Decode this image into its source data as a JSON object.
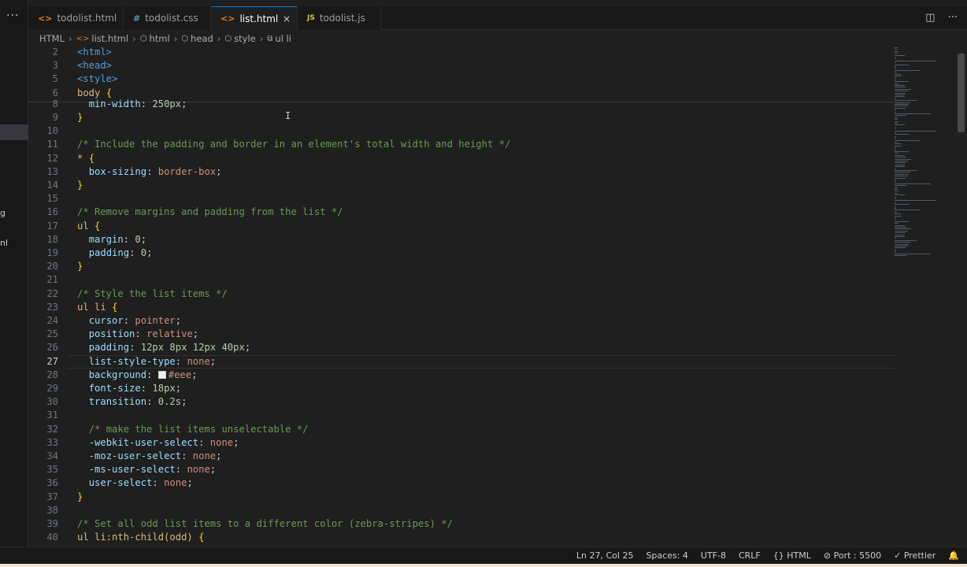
{
  "sidebar": {
    "menu_icon": "ellipsis-icon",
    "fragments": [
      "g",
      "nl"
    ]
  },
  "tabs": [
    {
      "label": "todolist.html",
      "icon": "html-file-icon",
      "icon_glyph": "<>",
      "active": false
    },
    {
      "label": "todolist.css",
      "icon": "css-file-icon",
      "icon_glyph": "#",
      "active": false
    },
    {
      "label": "list.html",
      "icon": "html-file-icon",
      "icon_glyph": "<>",
      "active": true
    },
    {
      "label": "todolist.js",
      "icon": "js-file-icon",
      "icon_glyph": "JS",
      "active": false
    }
  ],
  "tab_close": "×",
  "breadcrumb": [
    {
      "label": "HTML",
      "icon": ""
    },
    {
      "label": "list.html",
      "icon": "html-file-icon"
    },
    {
      "label": "html",
      "icon": "symbol-element-icon"
    },
    {
      "label": "head",
      "icon": "symbol-element-icon"
    },
    {
      "label": "style",
      "icon": "symbol-element-icon"
    },
    {
      "label": "ul li",
      "icon": "symbol-class-icon"
    }
  ],
  "editor": {
    "current_line": 27,
    "lines": [
      {
        "n": "2",
        "tokens": [
          [
            "t-tag",
            "<html>"
          ]
        ]
      },
      {
        "n": "3",
        "tokens": [
          [
            "t-tag",
            "<head>"
          ]
        ]
      },
      {
        "n": "5",
        "tokens": [
          [
            "t-tag",
            "<style>"
          ]
        ]
      },
      {
        "n": "6",
        "tokens": [
          [
            "t-sel",
            "body"
          ],
          [
            "t-pun",
            " "
          ],
          [
            "t-brace",
            "{"
          ]
        ]
      },
      {
        "n": "8",
        "tokens": [
          [
            "t-pun",
            "  "
          ],
          [
            "t-prop",
            "min-width"
          ],
          [
            "t-pun",
            ": "
          ],
          [
            "t-num",
            "250px"
          ],
          [
            "t-pun",
            ";"
          ]
        ]
      },
      {
        "n": "9",
        "tokens": [
          [
            "t-brace",
            "}"
          ]
        ]
      },
      {
        "n": "10",
        "tokens": []
      },
      {
        "n": "11",
        "tokens": [
          [
            "t-com",
            "/* Include the padding and border in an element's total width and height */"
          ]
        ]
      },
      {
        "n": "12",
        "tokens": [
          [
            "t-sel",
            "*"
          ],
          [
            "t-pun",
            " "
          ],
          [
            "t-brace",
            "{"
          ]
        ]
      },
      {
        "n": "13",
        "tokens": [
          [
            "t-pun",
            "  "
          ],
          [
            "t-prop",
            "box-sizing"
          ],
          [
            "t-pun",
            ": "
          ],
          [
            "t-val",
            "border-box"
          ],
          [
            "t-pun",
            ";"
          ]
        ]
      },
      {
        "n": "14",
        "tokens": [
          [
            "t-brace",
            "}"
          ]
        ]
      },
      {
        "n": "15",
        "tokens": []
      },
      {
        "n": "16",
        "tokens": [
          [
            "t-com",
            "/* Remove margins and padding from the list */"
          ]
        ]
      },
      {
        "n": "17",
        "tokens": [
          [
            "t-sel",
            "ul"
          ],
          [
            "t-pun",
            " "
          ],
          [
            "t-brace",
            "{"
          ]
        ]
      },
      {
        "n": "18",
        "tokens": [
          [
            "t-pun",
            "  "
          ],
          [
            "t-prop",
            "margin"
          ],
          [
            "t-pun",
            ": "
          ],
          [
            "t-num",
            "0"
          ],
          [
            "t-pun",
            ";"
          ]
        ]
      },
      {
        "n": "19",
        "tokens": [
          [
            "t-pun",
            "  "
          ],
          [
            "t-prop",
            "padding"
          ],
          [
            "t-pun",
            ": "
          ],
          [
            "t-num",
            "0"
          ],
          [
            "t-pun",
            ";"
          ]
        ]
      },
      {
        "n": "20",
        "tokens": [
          [
            "t-brace",
            "}"
          ]
        ]
      },
      {
        "n": "21",
        "tokens": []
      },
      {
        "n": "22",
        "tokens": [
          [
            "t-com",
            "/* Style the list items */"
          ]
        ]
      },
      {
        "n": "23",
        "tokens": [
          [
            "t-sel",
            "ul li"
          ],
          [
            "t-pun",
            " "
          ],
          [
            "t-brace",
            "{"
          ]
        ]
      },
      {
        "n": "24",
        "tokens": [
          [
            "t-pun",
            "  "
          ],
          [
            "t-prop",
            "cursor"
          ],
          [
            "t-pun",
            ": "
          ],
          [
            "t-val",
            "pointer"
          ],
          [
            "t-pun",
            ";"
          ]
        ]
      },
      {
        "n": "25",
        "tokens": [
          [
            "t-pun",
            "  "
          ],
          [
            "t-prop",
            "position"
          ],
          [
            "t-pun",
            ": "
          ],
          [
            "t-val",
            "relative"
          ],
          [
            "t-pun",
            ";"
          ]
        ]
      },
      {
        "n": "26",
        "tokens": [
          [
            "t-pun",
            "  "
          ],
          [
            "t-prop",
            "padding"
          ],
          [
            "t-pun",
            ": "
          ],
          [
            "t-num",
            "12px 8px 12px 40px"
          ],
          [
            "t-pun",
            ";"
          ]
        ]
      },
      {
        "n": "27",
        "tokens": [
          [
            "t-pun",
            "  "
          ],
          [
            "t-prop",
            "list-style-type"
          ],
          [
            "t-pun",
            ": "
          ],
          [
            "t-val",
            "none"
          ],
          [
            "t-pun",
            ";"
          ]
        ]
      },
      {
        "n": "28",
        "tokens": [
          [
            "t-pun",
            "  "
          ],
          [
            "t-prop",
            "background"
          ],
          [
            "t-pun",
            ": "
          ],
          [
            "swatch",
            ""
          ],
          [
            "t-val",
            "#eee"
          ],
          [
            "t-pun",
            ";"
          ]
        ]
      },
      {
        "n": "29",
        "tokens": [
          [
            "t-pun",
            "  "
          ],
          [
            "t-prop",
            "font-size"
          ],
          [
            "t-pun",
            ": "
          ],
          [
            "t-num",
            "18px"
          ],
          [
            "t-pun",
            ";"
          ]
        ]
      },
      {
        "n": "30",
        "tokens": [
          [
            "t-pun",
            "  "
          ],
          [
            "t-prop",
            "transition"
          ],
          [
            "t-pun",
            ": "
          ],
          [
            "t-num",
            "0.2s"
          ],
          [
            "t-pun",
            ";"
          ]
        ]
      },
      {
        "n": "31",
        "tokens": []
      },
      {
        "n": "32",
        "tokens": [
          [
            "t-pun",
            "  "
          ],
          [
            "t-com",
            "/* make the list items unselectable */"
          ]
        ]
      },
      {
        "n": "33",
        "tokens": [
          [
            "t-pun",
            "  "
          ],
          [
            "t-prop",
            "-webkit-user-select"
          ],
          [
            "t-pun",
            ": "
          ],
          [
            "t-val",
            "none"
          ],
          [
            "t-pun",
            ";"
          ]
        ]
      },
      {
        "n": "34",
        "tokens": [
          [
            "t-pun",
            "  "
          ],
          [
            "t-prop",
            "-moz-user-select"
          ],
          [
            "t-pun",
            ": "
          ],
          [
            "t-val",
            "none"
          ],
          [
            "t-pun",
            ";"
          ]
        ]
      },
      {
        "n": "35",
        "tokens": [
          [
            "t-pun",
            "  "
          ],
          [
            "t-prop",
            "-ms-user-select"
          ],
          [
            "t-pun",
            ": "
          ],
          [
            "t-val",
            "none"
          ],
          [
            "t-pun",
            ";"
          ]
        ]
      },
      {
        "n": "36",
        "tokens": [
          [
            "t-pun",
            "  "
          ],
          [
            "t-prop",
            "user-select"
          ],
          [
            "t-pun",
            ": "
          ],
          [
            "t-val",
            "none"
          ],
          [
            "t-pun",
            ";"
          ]
        ]
      },
      {
        "n": "37",
        "tokens": [
          [
            "t-brace",
            "}"
          ]
        ]
      },
      {
        "n": "38",
        "tokens": []
      },
      {
        "n": "39",
        "tokens": [
          [
            "t-com",
            "/* Set all odd list items to a different color (zebra-stripes) */"
          ]
        ]
      },
      {
        "n": "40",
        "tokens": [
          [
            "t-sel",
            "ul li:nth-child(odd)"
          ],
          [
            "t-pun",
            " "
          ],
          [
            "t-brace",
            "{"
          ]
        ]
      }
    ]
  },
  "status": {
    "position": "Ln 27, Col 25",
    "spaces": "Spaces: 4",
    "encoding": "UTF-8",
    "eol": "CRLF",
    "language": "HTML",
    "port": "Port : 5500",
    "formatter": "Prettier"
  },
  "colors": {
    "accent": "#0078d4",
    "background": "#1f1f1f",
    "html_icon": "#e37933",
    "css_icon": "#519aba",
    "js_icon": "#cbcb41"
  }
}
